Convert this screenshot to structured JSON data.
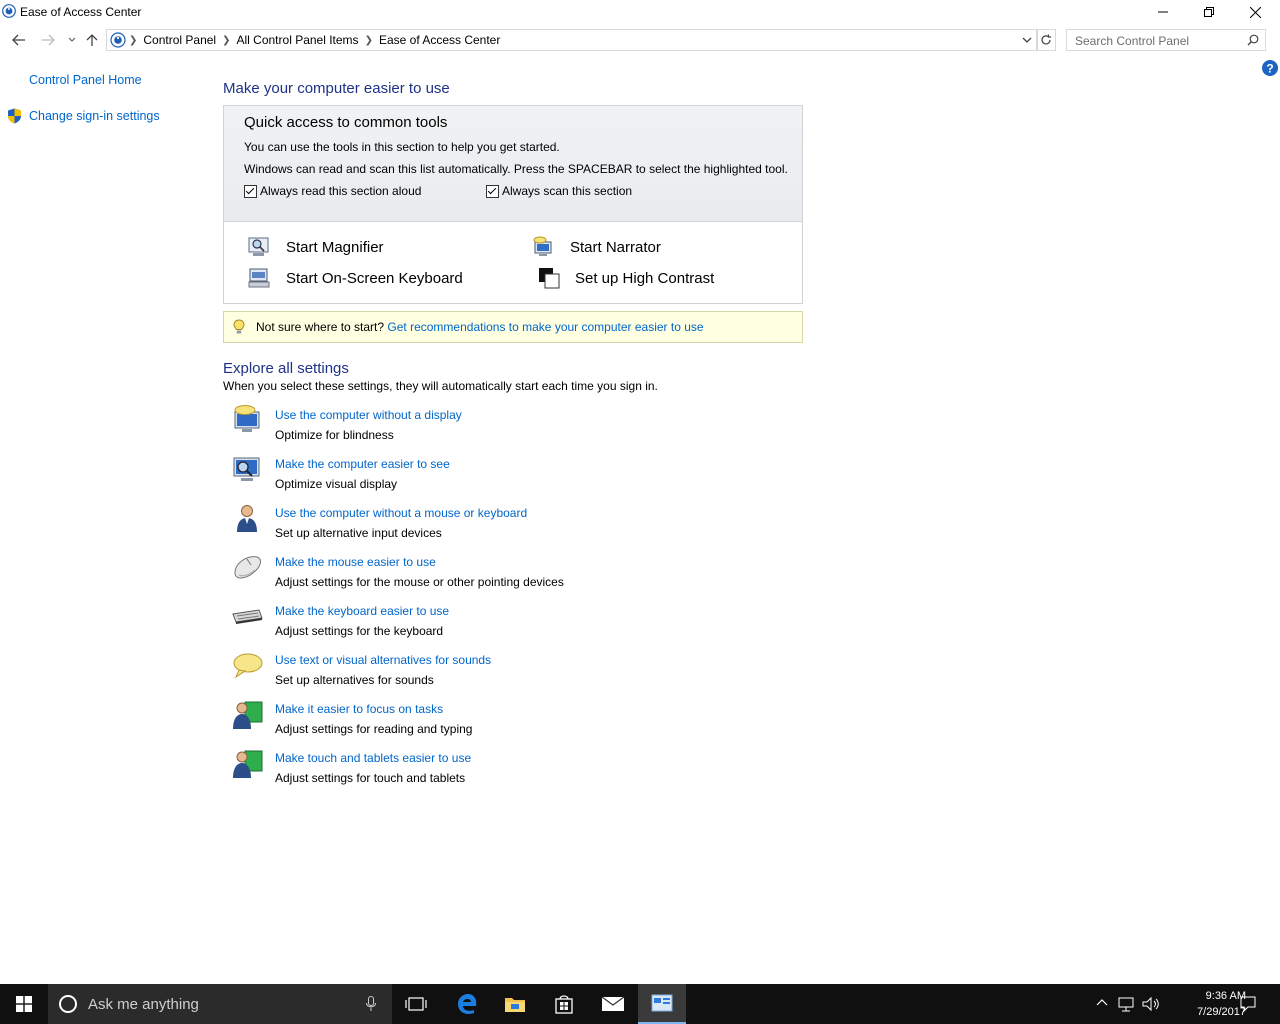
{
  "window": {
    "title": "Ease of Access Center"
  },
  "address": {
    "breadcrumbs": [
      "Control Panel",
      "All Control Panel Items",
      "Ease of Access Center"
    ],
    "search_placeholder": "Search Control Panel"
  },
  "left_pane": {
    "home": "Control Panel Home",
    "signin": "Change sign-in settings"
  },
  "main": {
    "heading": "Make your computer easier to use",
    "quick": {
      "title": "Quick access to common tools",
      "line1": "You can use the tools in this section to help you get started.",
      "line2": "Windows can read and scan this list automatically.  Press the SPACEBAR to select the highlighted tool.",
      "checkbox_read": "Always read this section aloud",
      "checkbox_scan": "Always scan this section",
      "tools": {
        "magnifier": "Start Magnifier",
        "narrator": "Start Narrator",
        "osk": "Start On-Screen Keyboard",
        "contrast": "Set up High Contrast"
      }
    },
    "tip": {
      "prefix": "Not sure where to start?",
      "link": "Get recommendations to make your computer easier to use"
    },
    "explore": {
      "heading": "Explore all settings",
      "subtext": "When you select these settings, they will automatically start each time you sign in.",
      "items": [
        {
          "link": "Use the computer without a display",
          "desc": "Optimize for blindness",
          "icon": "monitor-speech-icon"
        },
        {
          "link": "Make the computer easier to see",
          "desc": "Optimize visual display",
          "icon": "monitor-magnify-icon"
        },
        {
          "link": "Use the computer without a mouse or keyboard",
          "desc": "Set up alternative input devices",
          "icon": "person-icon"
        },
        {
          "link": "Make the mouse easier to use",
          "desc": "Adjust settings for the mouse or other pointing devices",
          "icon": "mouse-icon"
        },
        {
          "link": "Make the keyboard easier to use",
          "desc": "Adjust settings for the keyboard",
          "icon": "keyboard-icon"
        },
        {
          "link": "Use text or visual alternatives for sounds",
          "desc": "Set up alternatives for sounds",
          "icon": "speech-bubble-icon"
        },
        {
          "link": "Make it easier to focus on tasks",
          "desc": "Adjust settings for reading and typing",
          "icon": "person-monitor-icon"
        },
        {
          "link": "Make touch and tablets easier to use",
          "desc": "Adjust settings for touch and tablets",
          "icon": "person-tablet-icon"
        }
      ]
    }
  },
  "taskbar": {
    "search_text": "Ask me anything",
    "time": "9:36 AM",
    "date": "7/29/2017"
  }
}
